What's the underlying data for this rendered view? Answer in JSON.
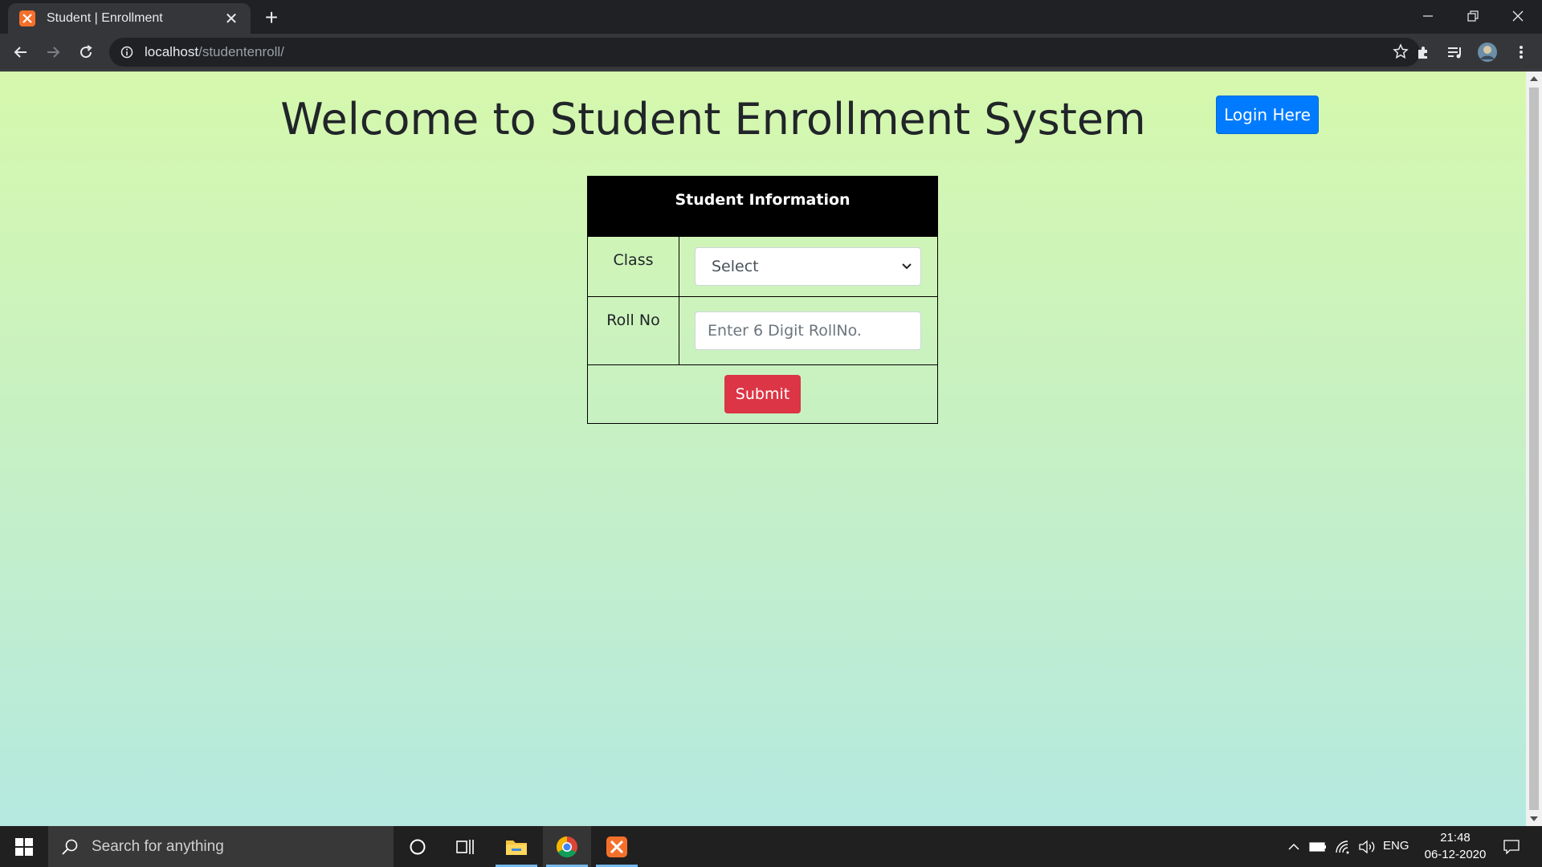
{
  "browser": {
    "tab_title": "Student | Enrollment",
    "url_host": "localhost",
    "url_path": "/studentenroll/"
  },
  "page": {
    "heading": "Welcome to Student Enrollment System",
    "login_label": "Login Here",
    "table_header": "Student Information",
    "class_label": "Class",
    "class_select_value": "Select",
    "roll_label": "Roll No",
    "roll_placeholder": "Enter 6 Digit RollNo.",
    "submit_label": "Submit"
  },
  "taskbar": {
    "search_placeholder": "Search for anything",
    "language": "ENG",
    "time": "21:48",
    "date": "06-12-2020"
  },
  "colors": {
    "login_button": "#007bff",
    "submit_button": "#dc3545",
    "table_header_bg": "#000000",
    "page_gradient_top": "#d6f8ad",
    "page_gradient_bottom": "#b5e9e0"
  }
}
